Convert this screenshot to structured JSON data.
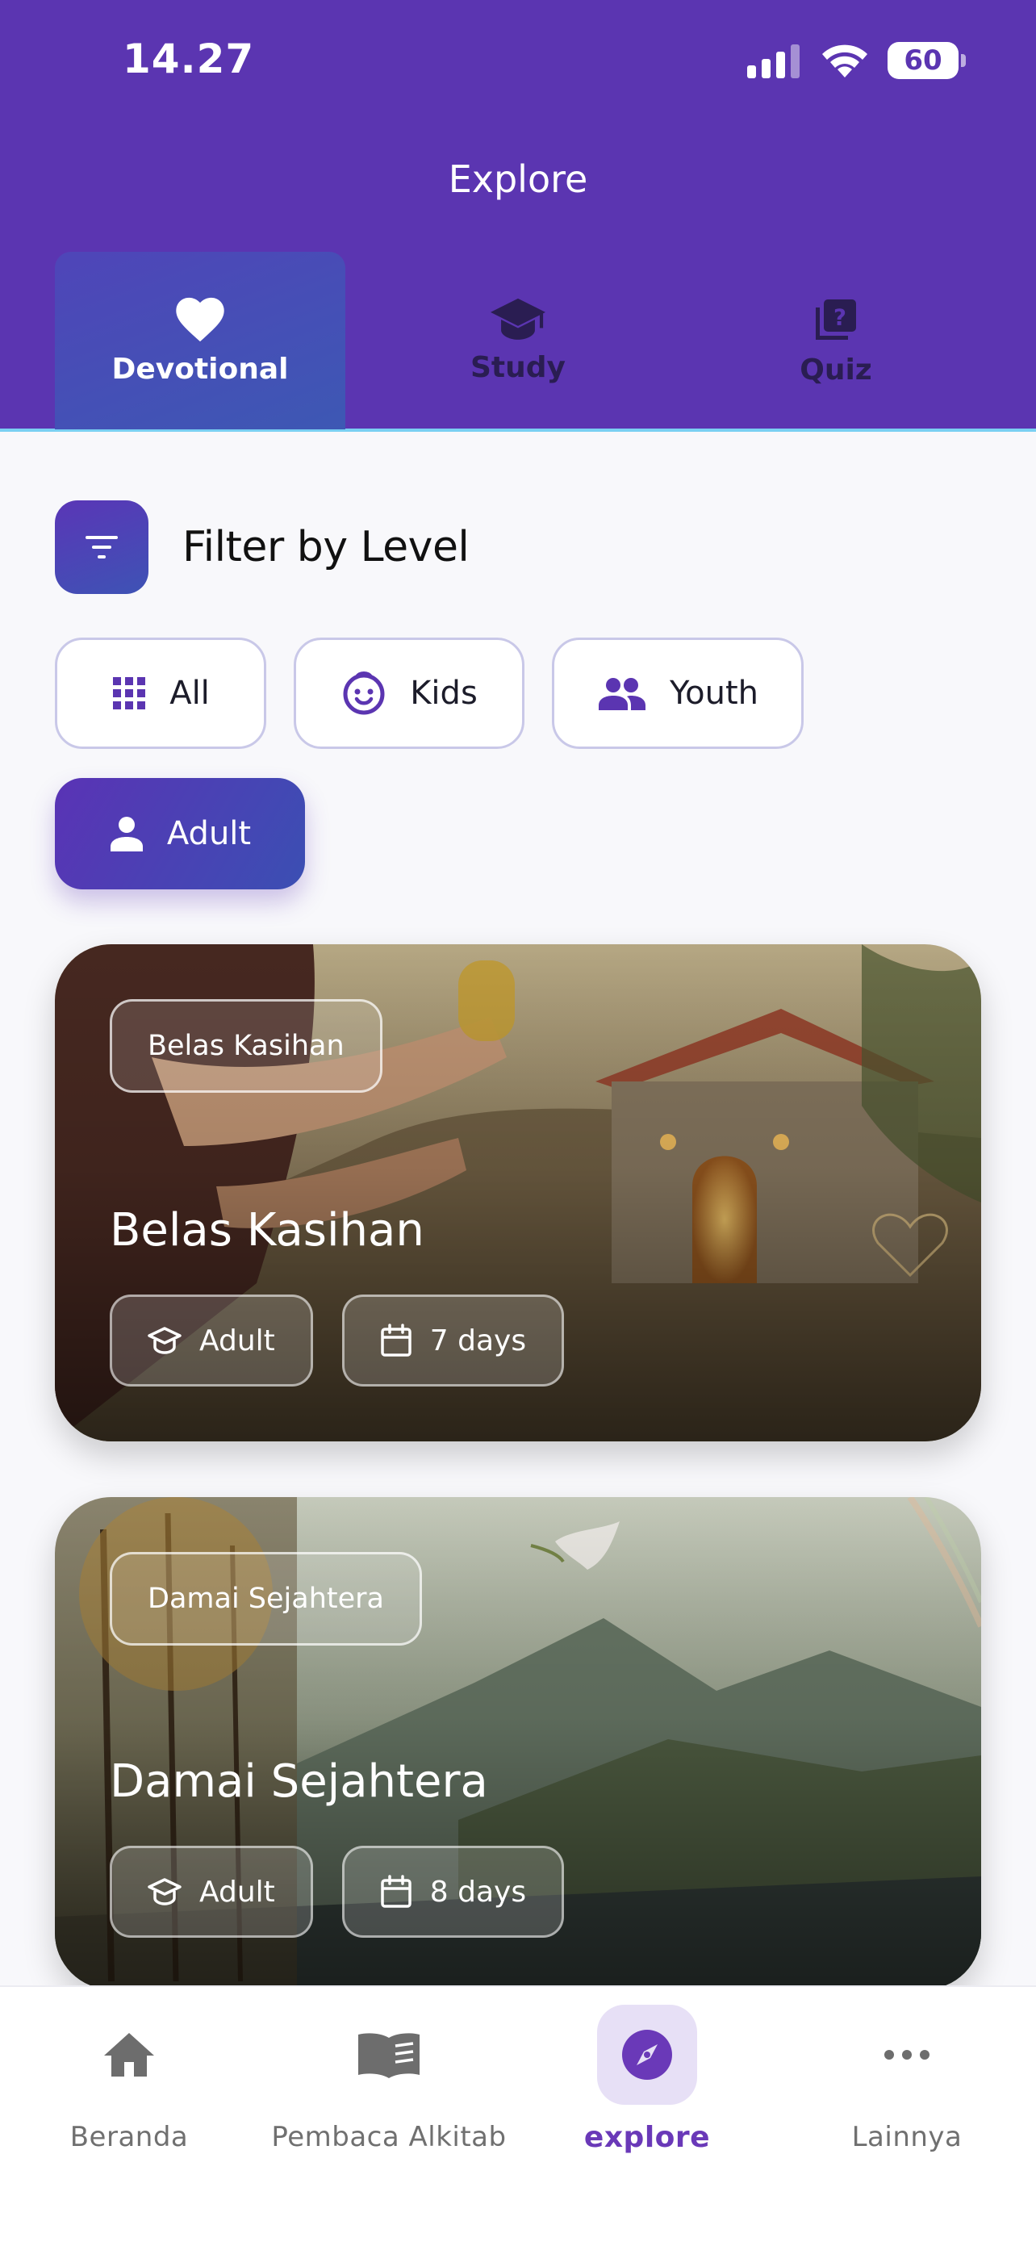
{
  "status": {
    "time": "14.27",
    "battery": "60"
  },
  "header": {
    "title": "Explore"
  },
  "tabs": [
    {
      "label": "Devotional",
      "icon": "heart-icon",
      "active": true
    },
    {
      "label": "Study",
      "icon": "graduation-cap-icon",
      "active": false
    },
    {
      "label": "Quiz",
      "icon": "quiz-icon",
      "active": false
    }
  ],
  "filter": {
    "title": "Filter by Level",
    "chips": [
      {
        "label": "All",
        "icon": "grid-icon",
        "active": false
      },
      {
        "label": "Kids",
        "icon": "child-face-icon",
        "active": false
      },
      {
        "label": "Youth",
        "icon": "group-icon",
        "active": false
      },
      {
        "label": "Adult",
        "icon": "person-icon",
        "active": true
      }
    ]
  },
  "cards": [
    {
      "tag": "Belas Kasihan",
      "title": "Belas Kasihan",
      "level": "Adult",
      "duration": "7 days"
    },
    {
      "tag": "Damai Sejahtera",
      "title": "Damai Sejahtera",
      "level": "Adult",
      "duration": "8 days"
    }
  ],
  "bottom_nav": [
    {
      "label": "Beranda",
      "icon": "home-icon",
      "active": false
    },
    {
      "label": "Pembaca Alkitab",
      "icon": "book-icon",
      "active": false
    },
    {
      "label": "explore",
      "icon": "compass-icon",
      "active": true
    },
    {
      "label": "Lainnya",
      "icon": "more-icon",
      "active": false
    }
  ],
  "colors": {
    "primary": "#5b35b1",
    "accent": "#3e53b5",
    "nav_active": "#6a39b8"
  }
}
